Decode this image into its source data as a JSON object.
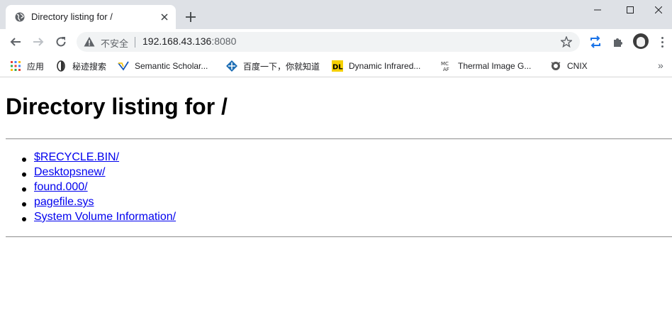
{
  "tab": {
    "title": "Directory listing for /"
  },
  "omnibox": {
    "security": "不安全",
    "host": "192.168.43.136",
    "port": ":8080"
  },
  "bookmarks": [
    {
      "label": "应用",
      "icon": "apps-grid-icon"
    },
    {
      "label": "秘迹搜索",
      "icon": "mijisou-icon"
    },
    {
      "label": "Semantic Scholar...",
      "icon": "semantic-scholar-icon"
    },
    {
      "label": "百度一下，你就知道",
      "icon": "baidu-icon"
    },
    {
      "label": "Dynamic Infrared...",
      "icon": "dl-icon"
    },
    {
      "label": "Thermal Image G...",
      "icon": "mcaf-icon"
    },
    {
      "label": "CNIX",
      "icon": "cnix-icon"
    }
  ],
  "page": {
    "heading": "Directory listing for /",
    "entries": [
      "$RECYCLE.BIN/",
      "Desktopsnew/",
      "found.000/",
      "pagefile.sys",
      "System Volume Information/"
    ]
  },
  "colors": {
    "link": "#0000ee",
    "tabstrip": "#dee1e6",
    "omnibox": "#f1f3f4",
    "extension_accent": "#1a73e8"
  }
}
